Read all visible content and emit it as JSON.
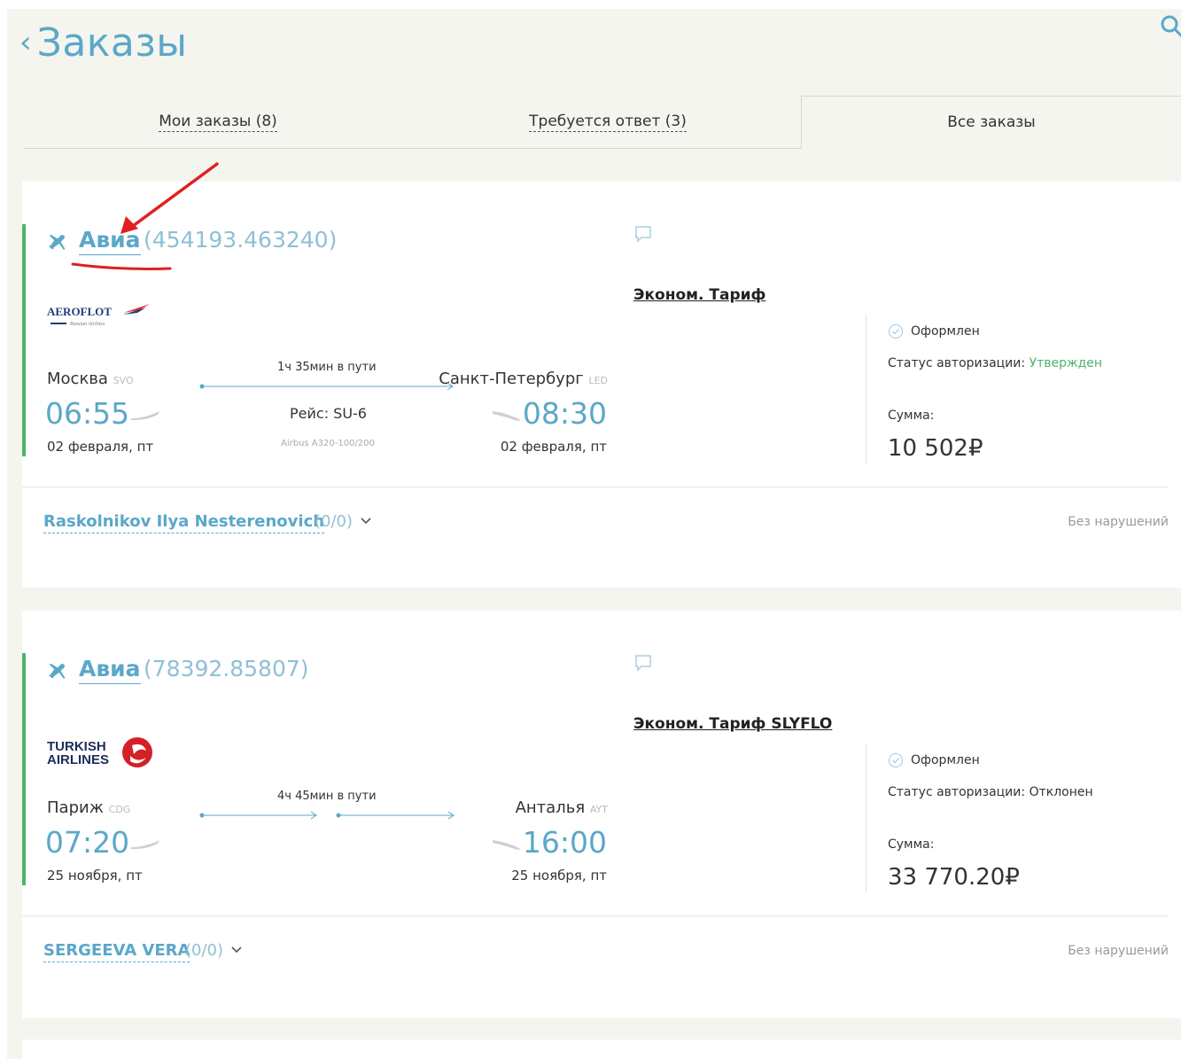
{
  "header": {
    "back_icon": "chevron-left-icon",
    "title": "Заказы",
    "search_icon": "search-icon"
  },
  "tabs": [
    {
      "label": "Мои заказы (8)"
    },
    {
      "label": "Требуется ответ (3)"
    },
    {
      "label": "Все заказы",
      "active": true
    }
  ],
  "orders": [
    {
      "type": "Авиа",
      "number": "(454193.463240)",
      "airline": "AEROFLOT",
      "airline_sub": "Russian Airlines",
      "tariff": "Эконом. Тариф",
      "from_city": "Москва",
      "from_iata": "SVO",
      "to_city": "Санкт-Петербург",
      "to_iata": "LED",
      "dep_time": "06:55",
      "arr_time": "08:30",
      "dep_date": "02 февраля, пт",
      "arr_date": "02 февраля, пт",
      "duration": "1ч 35мин в пути",
      "flight": "Рейс: SU-6",
      "aircraft": "Airbus A320-100/200",
      "status": "Оформлен",
      "auth_label": "Статус авторизации: ",
      "auth_value": "Утвержден",
      "sum_label": "Сумма:",
      "sum_value": "10 502₽",
      "traveler": "Raskolnikov Ilya Nesterenovich",
      "traveler_count": "(0/0)",
      "violations": "Без нарушений"
    },
    {
      "type": "Авиа",
      "number": "(78392.85807)",
      "airline": "TURKISH AIRLINES",
      "tariff": "Эконом. Тариф SLYFLO",
      "from_city": "Париж",
      "from_iata": "CDG",
      "to_city": "Анталья",
      "to_iata": "AYT",
      "dep_time": "07:20",
      "arr_time": "16:00",
      "dep_date": "25 ноября, пт",
      "arr_date": "25 ноября, пт",
      "duration": "4ч 45мин в пути",
      "status": "Оформлен",
      "auth_label": "Статус авторизации: ",
      "auth_value": "Отклонен",
      "sum_label": "Сумма:",
      "sum_value": "33 770.20₽",
      "traveler": "SERGEEVA VERA",
      "traveler_count": "(0/0)",
      "violations": "Без нарушений"
    }
  ],
  "colors": {
    "accent": "#5ba7c9",
    "success": "#4fb36b",
    "annotation": "#e02020"
  }
}
